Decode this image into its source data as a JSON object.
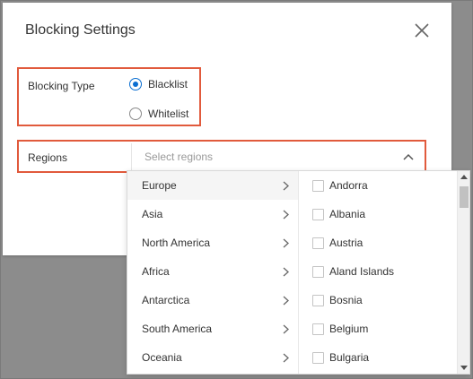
{
  "dialog": {
    "title": "Blocking Settings"
  },
  "blocking_type": {
    "label": "Blocking Type",
    "options": [
      {
        "label": "Blacklist",
        "selected": true
      },
      {
        "label": "Whitelist",
        "selected": false
      }
    ]
  },
  "regions": {
    "label": "Regions",
    "placeholder": "Select regions",
    "continents": [
      "Europe",
      "Asia",
      "North America",
      "Africa",
      "Antarctica",
      "South America",
      "Oceania"
    ],
    "active_continent": "Europe",
    "countries": [
      "Andorra",
      "Albania",
      "Austria",
      "Aland Islands",
      "Bosnia",
      "Belgium",
      "Bulgaria"
    ]
  },
  "colors": {
    "highlight": "#e15a3c",
    "accent": "#0a6ed1",
    "overlay": "#8c8c8c"
  }
}
